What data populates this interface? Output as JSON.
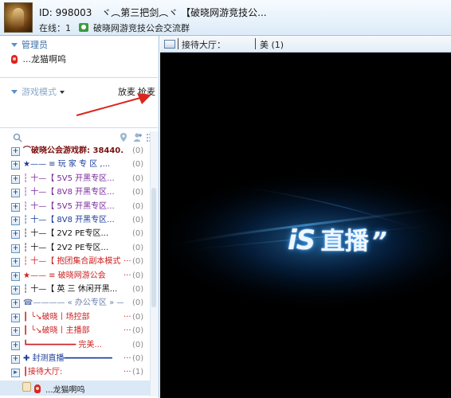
{
  "header": {
    "channel_id": "ID: 998003",
    "channel_name": "ヾ︵第三把剑︵ヾ",
    "channel_group": "【破晓网游竞技公...",
    "online_text": "在线：1",
    "group_text": "破晓网游竞技公会交流群"
  },
  "left": {
    "admin_title": "管理员",
    "admin_user": "...龙猫啊呜",
    "mode_label": "游戏模式",
    "mic_release": "放麦",
    "mic_grab": "抢麦",
    "channels": [
      {
        "name": "⌒破晓公会游戏群: 38440...",
        "count": "(0)",
        "color": "#7a1010",
        "bold": true
      },
      {
        "name": "★—— ≡ 玩 家 专 区 ,...",
        "count": "(0)",
        "color": "#1b3c9a",
        "bold": false
      },
      {
        "name": "┆ 十—【 5V5  开黑专区...",
        "count": "(0)",
        "color": "#7a2a9a",
        "bold": false
      },
      {
        "name": "┆ 十—【 8V8  开黑专区...",
        "count": "(0)",
        "color": "#7a2a9a",
        "bold": false
      },
      {
        "name": "┆ 十—【 5V5  开黑专区...",
        "count": "(0)",
        "color": "#7a2a9a",
        "bold": false
      },
      {
        "name": "┆ 十—【 8V8  开黑专区...",
        "count": "(0)",
        "color": "#1b3c9a",
        "bold": false
      },
      {
        "name": "┆ 十—【 2V2  PE专区...",
        "count": "(0)",
        "color": "#111111",
        "bold": false
      },
      {
        "name": "┆ 十—【 2V2  PE专区...",
        "count": "(0)",
        "color": "#111111",
        "bold": false
      },
      {
        "name": "┆ 十—【 抱团集合副本模式",
        "count": "(0)",
        "color": "#cc2222",
        "bold": false,
        "dots": true
      },
      {
        "name": "★—— ≡ 破晓网游公会",
        "count": "(0)",
        "color": "#cc2222",
        "bold": false,
        "dots": true
      },
      {
        "name": "┆ 十—【  英 三  休闲开黑...",
        "count": "(0)",
        "color": "#111111",
        "bold": false
      },
      {
        "name": "☎———— « 办公专区 » ——...",
        "count": "(0)",
        "color": "#6b7fb0",
        "bold": false
      },
      {
        "name": "┃ ╰↘破晓丨场控部",
        "count": "(0)",
        "color": "#cc2222",
        "bold": false,
        "dots": true
      },
      {
        "name": "┃ ╰↘破晓丨主播部",
        "count": "(0)",
        "color": "#cc2222",
        "bold": false,
        "dots": true
      },
      {
        "name": "┗━━━━━━━━━━ 完美...",
        "count": "(0)",
        "color": "#cc2222",
        "bold": false
      },
      {
        "name": "✚ 封测直播━━━━━━━━━━",
        "count": "(0)",
        "color": "#1b3c9a",
        "bold": false,
        "dots": true
      },
      {
        "name": "┃接待大厅:",
        "count": "(1)",
        "color": "#cc2222",
        "bold": false,
        "dots": true
      }
    ],
    "lobby_user": "...龙猫啊呜"
  },
  "right": {
    "hall_label": "接待大厅：",
    "user_count": "美 (1)"
  },
  "video": {
    "logo_is": "iS",
    "logo_cn": "直播",
    "logo_tail": "”"
  },
  "colors": {
    "accent": "#3a6fa7",
    "arrow": "#d9271f",
    "logo_glow": "#33a6ff"
  }
}
